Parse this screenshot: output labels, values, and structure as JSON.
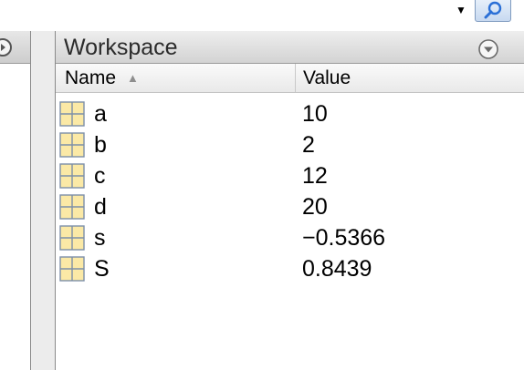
{
  "toolbar": {
    "dropdown_icon": "triangle-down-icon",
    "search_icon": "magnifier-icon",
    "accent_color": "#2a6fd6"
  },
  "left_panel": {
    "menu_icon": "circle-menu-icon"
  },
  "workspace": {
    "title": "Workspace",
    "menu_icon": "circle-chevron-down-icon",
    "columns": {
      "name": "Name",
      "value": "Value",
      "sort_icon": "sort-ascending-icon"
    },
    "variables": [
      {
        "name": "a",
        "value": "10",
        "icon": "matrix-icon"
      },
      {
        "name": "b",
        "value": "2",
        "icon": "matrix-icon"
      },
      {
        "name": "c",
        "value": "12",
        "icon": "matrix-icon"
      },
      {
        "name": "d",
        "value": "20",
        "icon": "matrix-icon"
      },
      {
        "name": "s",
        "value": "−0.5366",
        "icon": "matrix-icon"
      },
      {
        "name": "S",
        "value": "0.8439",
        "icon": "matrix-icon"
      }
    ]
  }
}
